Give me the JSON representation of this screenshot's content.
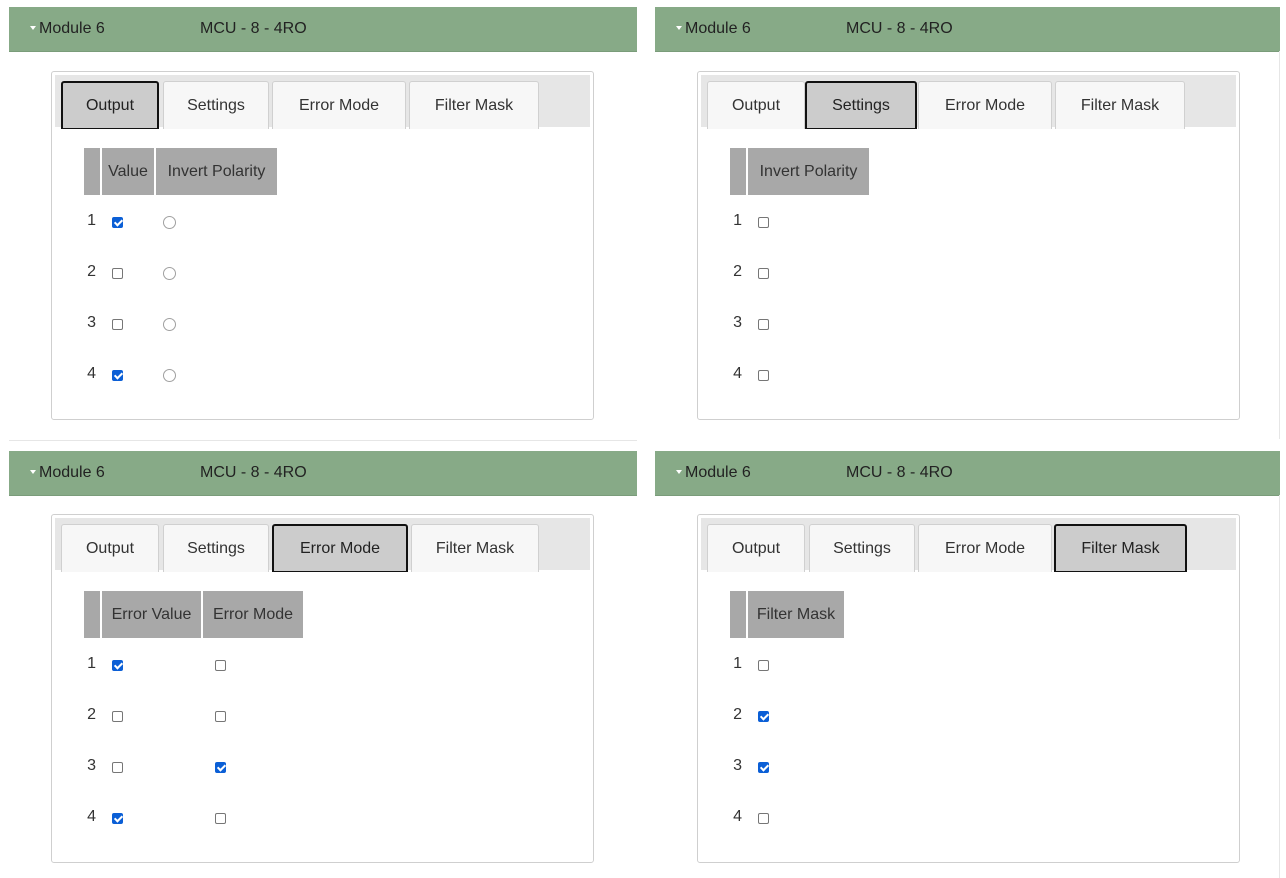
{
  "panels": [
    {
      "module_title": "Module 6",
      "module_type": "MCU - 8 - 4RO",
      "tabs": [
        "Output",
        "Settings",
        "Error Mode",
        "Filter Mask"
      ],
      "active_tab": "Output",
      "columns": [
        "Value",
        "Invert Polarity"
      ],
      "rows": [
        {
          "num": "1",
          "value": true,
          "invert_polarity": false
        },
        {
          "num": "2",
          "value": false,
          "invert_polarity": false
        },
        {
          "num": "3",
          "value": false,
          "invert_polarity": false
        },
        {
          "num": "4",
          "value": true,
          "invert_polarity": false
        }
      ]
    },
    {
      "module_title": "Module 6",
      "module_type": "MCU - 8 - 4RO",
      "tabs": [
        "Output",
        "Settings",
        "Error Mode",
        "Filter Mask"
      ],
      "active_tab": "Settings",
      "columns": [
        "Invert Polarity"
      ],
      "rows": [
        {
          "num": "1",
          "invert_polarity": false
        },
        {
          "num": "2",
          "invert_polarity": false
        },
        {
          "num": "3",
          "invert_polarity": false
        },
        {
          "num": "4",
          "invert_polarity": false
        }
      ]
    },
    {
      "module_title": "Module 6",
      "module_type": "MCU - 8 - 4RO",
      "tabs": [
        "Output",
        "Settings",
        "Error Mode",
        "Filter Mask"
      ],
      "active_tab": "Error Mode",
      "columns": [
        "Error Value",
        "Error Mode"
      ],
      "rows": [
        {
          "num": "1",
          "error_value": true,
          "error_mode": false
        },
        {
          "num": "2",
          "error_value": false,
          "error_mode": false
        },
        {
          "num": "3",
          "error_value": false,
          "error_mode": true
        },
        {
          "num": "4",
          "error_value": true,
          "error_mode": false
        }
      ]
    },
    {
      "module_title": "Module 6",
      "module_type": "MCU - 8 - 4RO",
      "tabs": [
        "Output",
        "Settings",
        "Error Mode",
        "Filter Mask"
      ],
      "active_tab": "Filter Mask",
      "columns": [
        "Filter Mask"
      ],
      "rows": [
        {
          "num": "1",
          "filter_mask": false
        },
        {
          "num": "2",
          "filter_mask": true
        },
        {
          "num": "3",
          "filter_mask": true
        },
        {
          "num": "4",
          "filter_mask": false
        }
      ]
    }
  ],
  "colors": {
    "header_bg": "#87aa87",
    "checkbox_checked": "#0b5fd6",
    "active_tab_bg": "#cccccc",
    "table_header_bg": "#a8a8a8"
  }
}
